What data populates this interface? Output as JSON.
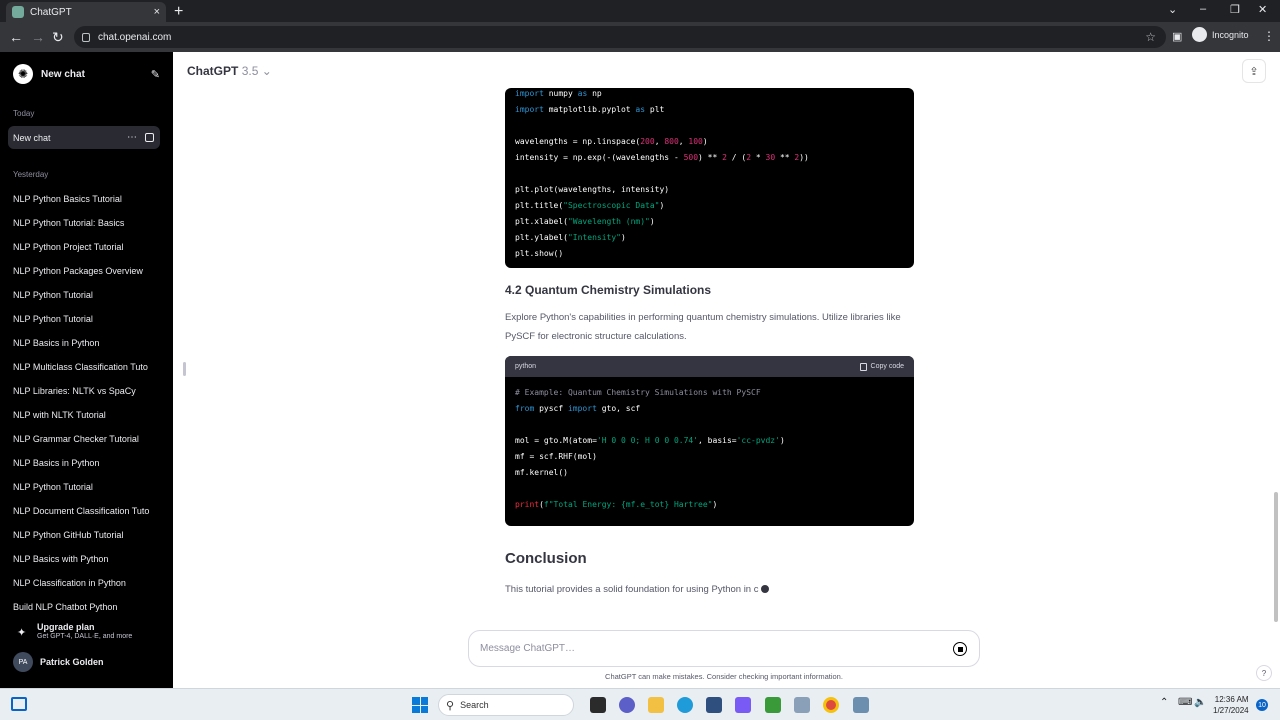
{
  "browser": {
    "tab_title": "ChatGPT",
    "new_tab_symbol": "+",
    "tab_close_symbol": "×",
    "url": "chat.openai.com",
    "profile_label": "Incognito",
    "nav_back": "←",
    "nav_forward": "→",
    "nav_reload": "↻",
    "bookmark_symbol": "☆",
    "menu_symbol": "⋮"
  },
  "sidebar": {
    "new_chat_label": "New chat",
    "today_label": "Today",
    "active_chat": "New chat",
    "yesterday_label": "Yesterday",
    "items": [
      "NLP Python Basics Tutorial",
      "NLP Python Tutorial: Basics",
      "NLP Python Project Tutorial",
      "NLP Python Packages Overview",
      "NLP Python Tutorial",
      "NLP Python Tutorial",
      "NLP Basics in Python",
      "NLP Multiclass Classification Tuto",
      "NLP Libraries: NLTK vs SpaCy",
      "NLP with NLTK Tutorial",
      "NLP Grammar Checker Tutorial",
      "NLP Basics in Python",
      "NLP Python Tutorial",
      "NLP Document Classification Tuto",
      "NLP Python GitHub Tutorial",
      "NLP Basics with Python",
      "NLP Classification in Python",
      "Build NLP Chatbot Python"
    ],
    "upgrade_title": "Upgrade plan",
    "upgrade_subtitle": "Get GPT-4, DALL·E, and more",
    "user_initials": "PA",
    "user_name": "Patrick Golden"
  },
  "header": {
    "model_name": "ChatGPT",
    "model_version": "3.5",
    "chevron": "⌄"
  },
  "content": {
    "code1_lines": [
      "import numpy as np",
      "import matplotlib.pyplot as plt",
      "",
      "wavelengths = np.linspace(200, 800, 100)",
      "intensity = np.exp(-(wavelengths - 500) ** 2 / (2 * 30 ** 2))",
      "",
      "plt.plot(wavelengths, intensity)",
      "plt.title(\"Spectroscopic Data\")",
      "plt.xlabel(\"Wavelength (nm)\")",
      "plt.ylabel(\"Intensity\")",
      "plt.show()"
    ],
    "section_heading": "4.2 Quantum Chemistry Simulations",
    "section_paragraph": "Explore Python's capabilities in performing quantum chemistry simulations. Utilize libraries like PySCF for electronic structure calculations.",
    "code2_language": "python",
    "code2_copy_label": "Copy code",
    "code2_lines": [
      "# Example: Quantum Chemistry Simulations with PySCF",
      "from pyscf import gto, scf",
      "",
      "mol = gto.M(atom='H 0 0 0; H 0 0 0.74', basis='cc-pvdz')",
      "mf = scf.RHF(mol)",
      "mf.kernel()",
      "",
      "print(f\"Total Energy: {mf.e_tot} Hartree\")"
    ],
    "conclusion_heading": "Conclusion",
    "conclusion_text": "This tutorial provides a solid foundation for using Python in c"
  },
  "composer": {
    "placeholder": "Message ChatGPT…",
    "disclaimer": "ChatGPT can make mistakes. Consider checking important information.",
    "help_symbol": "?"
  },
  "taskbar": {
    "search_label": "Search",
    "time": "12:36 AM",
    "date": "1/27/2024",
    "notification_count": "10"
  }
}
